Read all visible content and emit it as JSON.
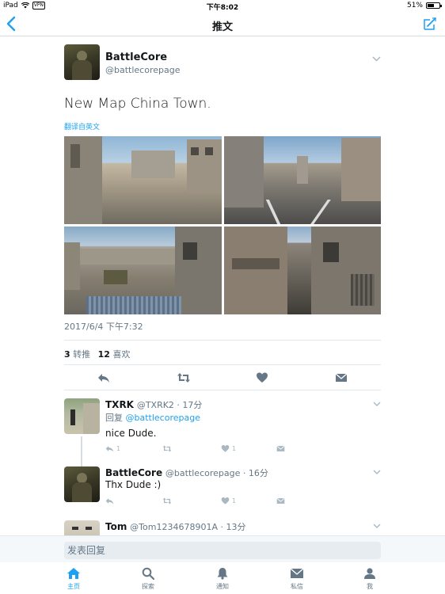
{
  "status_bar": {
    "device": "iPad",
    "vpn": "VPN",
    "time": "下午8:02",
    "battery": "51%",
    "battery_level": 0.51
  },
  "nav": {
    "title": "推文"
  },
  "tweet": {
    "author_name": "BattleCore",
    "author_handle": "@battlecorepage",
    "text": "New Map China Town.",
    "translate_label": "翻译自英文",
    "timestamp": "2017/6/4 下午7:32",
    "retweet_count": "3",
    "retweet_label": "转推",
    "like_count": "12",
    "like_label": "喜欢"
  },
  "replies": [
    {
      "name": "TXRK",
      "handle_time": "@TXRK2 · 17分",
      "reply_to_prefix": "回复",
      "reply_to_handle": "@battlecorepage",
      "text": "nice Dude.",
      "reply_count": "1",
      "like_count": "1"
    },
    {
      "name": "BattleCore",
      "handle_time": "@battlecorepage · 16分",
      "text": "Thx Dude :)",
      "like_count": "1"
    },
    {
      "name": "Tom",
      "handle_time": "@Tom1234678901A · 13分"
    }
  ],
  "compose": {
    "placeholder": "发表回复"
  },
  "tabs": [
    {
      "label": "主页",
      "icon": "home-icon"
    },
    {
      "label": "探索",
      "icon": "search-icon"
    },
    {
      "label": "通知",
      "icon": "bell-icon"
    },
    {
      "label": "私信",
      "icon": "mail-icon"
    },
    {
      "label": "我",
      "icon": "person-icon"
    }
  ],
  "colors": {
    "accent": "#1da1f2",
    "muted": "#657786",
    "icon_gray": "#aab8c2"
  }
}
